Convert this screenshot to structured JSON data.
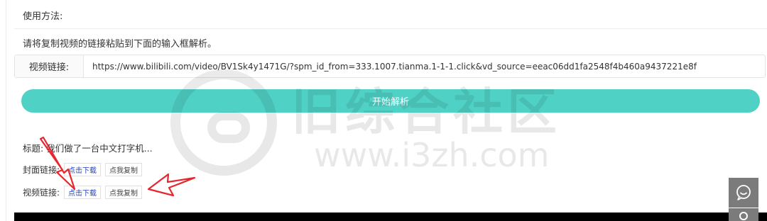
{
  "usage_title": "使用方法:",
  "instruction": "请将复制视频的链接粘贴到下面的输入框解析。",
  "link_input": {
    "label": "视频链接:",
    "value": "https://www.bilibili.com/video/BV1Sk4y1471G/?spm_id_from=333.1007.tianma.1-1-1.click&vd_source=eeac06dd1fa2548f4b460a9437221e8f"
  },
  "parse_button": "开始解析",
  "watermark": {
    "cn": "旧综合社区",
    "url": "www.i3zh.com"
  },
  "result": {
    "title_label": "标题:",
    "title_value": "我们做了一台中文打字机...",
    "cover_label": "封面链接:",
    "video_label": "视频链接:",
    "download_label": "点击下载",
    "copy_label": "点我复制"
  },
  "colors": {
    "accent": "#4fd1c5",
    "annotation": "#e8262e",
    "download_link": "#2440c8"
  },
  "icons": {
    "side_chat": "chat-bubble-icon",
    "side_user": "user-icon"
  }
}
